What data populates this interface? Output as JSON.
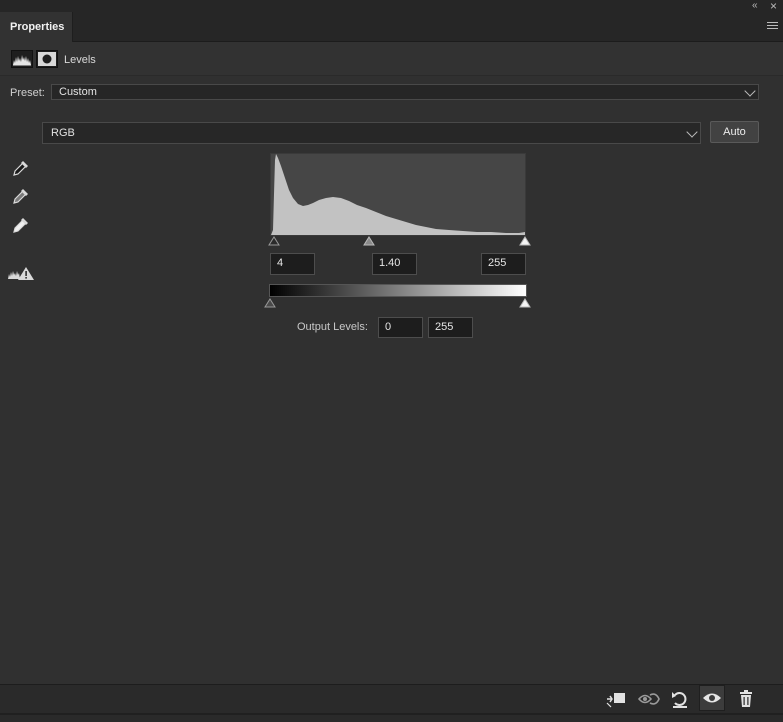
{
  "panel": {
    "tab_label": "Properties",
    "title": "Levels",
    "collapse_glyph": "«",
    "close_glyph": "×"
  },
  "preset": {
    "label": "Preset:",
    "value": "Custom"
  },
  "channel": {
    "value": "RGB",
    "auto_label": "Auto"
  },
  "input_levels": {
    "black": "4",
    "gamma": "1.40",
    "white": "255"
  },
  "output_levels": {
    "label": "Output Levels:",
    "black": "0",
    "white": "255"
  },
  "tools": [
    "black-point-eyedropper-icon",
    "gray-point-eyedropper-icon",
    "white-point-eyedropper-icon",
    "clipping-warning-icon"
  ],
  "footer_icons": [
    "clip-to-layer-icon",
    "view-previous-state-icon",
    "reset-icon",
    "visibility-eye-icon",
    "delete-trash-icon"
  ],
  "colors": {
    "panel_bg": "#303030",
    "histogram_bg": "#464646",
    "histogram_fill": "#c2c2c2"
  }
}
